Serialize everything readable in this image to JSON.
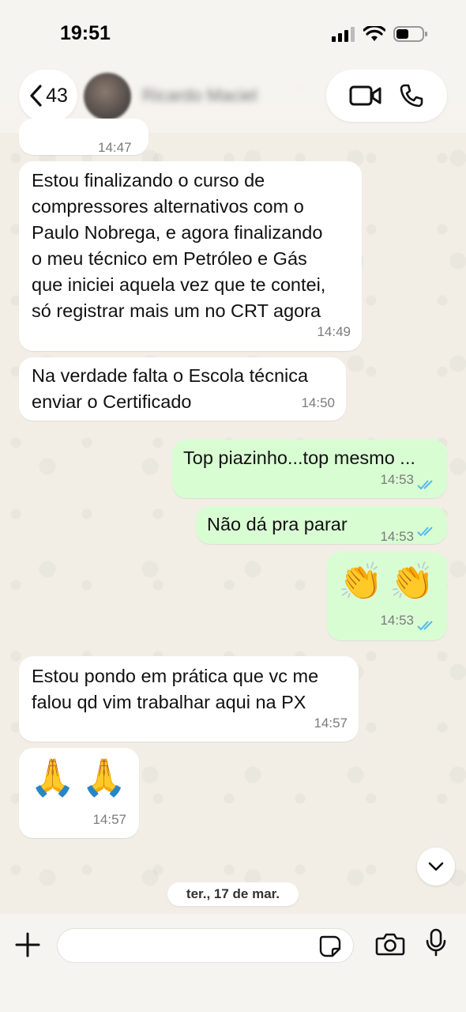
{
  "status": {
    "time": "19:51"
  },
  "header": {
    "back_count": "43",
    "contact_name": "Ricardo Maciel"
  },
  "messages": [
    {
      "time": "14:47"
    },
    {
      "text": "Estou finalizando o curso de\ncompressores alternativos com o\nPaulo Nobrega, e agora finalizando\no meu técnico em Petróleo e Gás\nque iniciei aquela vez que te contei,\nsó registrar mais um no CRT agora",
      "time": "14:49"
    },
    {
      "text": "Na verdade falta o Escola técnica\nenviar o Certificado",
      "time": "14:50"
    },
    {
      "text": "Top piazinho...top mesmo ...",
      "time": "14:53"
    },
    {
      "text": "Não dá pra parar",
      "time": "14:53"
    },
    {
      "text": "👏👏",
      "time": "14:53"
    },
    {
      "text": "Estou pondo em prática que vc me\nfalou qd vim trabalhar aqui na PX",
      "time": "14:57"
    },
    {
      "text": "🙏🙏",
      "time": "14:57"
    }
  ],
  "date_separator": "ter., 17 de mar.",
  "colors": {
    "incoming": "#ffffff",
    "outgoing": "#d9fdd3",
    "tick_read": "#53bdeb"
  },
  "icons": [
    "back-chevron-icon",
    "video-call-icon",
    "phone-icon",
    "chevron-down-icon",
    "plus-icon",
    "sticker-icon",
    "camera-icon",
    "microphone-icon"
  ]
}
